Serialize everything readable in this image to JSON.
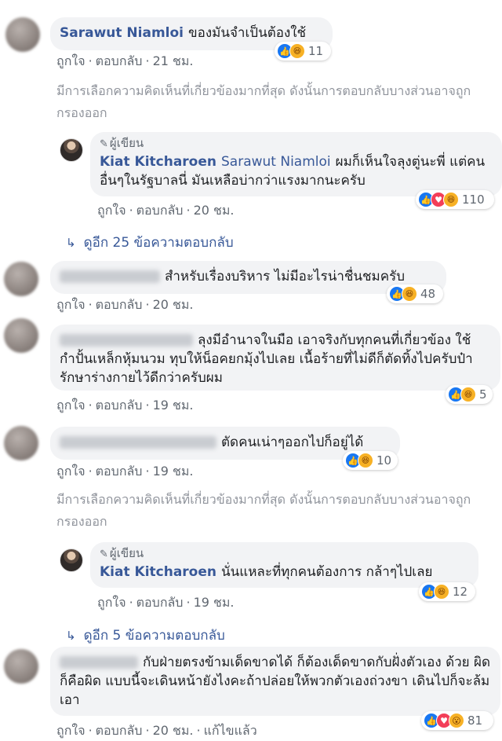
{
  "actions": {
    "like": "ถูกใจ",
    "reply": "ตอบกลับ",
    "edited": "แก้ไขแล้ว"
  },
  "notice": "มีการเลือกความคิดเห็นที่เกี่ยวข้องมากที่สุด ดังนั้นการตอบกลับบางส่วนอาจถูกกรองออก",
  "author_badge": "ผู้เขียน",
  "comments": [
    {
      "name": "Sarawut Niamloi",
      "text": "ของมันจำเป็นต้องใช้",
      "time": "21 ชม.",
      "reaction_count": "11",
      "reactions": [
        "like-icon",
        "haha-icon"
      ]
    },
    {
      "name": "Kiat Kitcharoen",
      "tag": "Sarawut Niamloi",
      "text": "ผมก็เห็นใจลุงตู่นะพี่ แต่คนอื่นๆในรัฐบาลนี่ มันเหลือบ่ากว่าแรงมากนะครับ",
      "time": "20 ชม.",
      "reaction_count": "110",
      "reactions": [
        "like-icon",
        "love-icon",
        "haha-icon"
      ]
    },
    {
      "more_replies": "ดูอีก 25 ข้อความตอบกลับ"
    },
    {
      "text": "สำหรับเรื่องบริหาร ไม่มีอะไรน่าชื่นชมครับ",
      "time": "20 ชม.",
      "reaction_count": "48",
      "reactions": [
        "like-icon",
        "haha-icon"
      ]
    },
    {
      "text": "ลุงมีอำนาจในมือ เอาจริงกับทุกคนที่เกี่ยวข้อง ใช้กำปั้นเหล็กหุ้มนวม ทุบให้น็อคยกมุ้งไปเลย เนื้อร้ายที่ไม่ดีก็ตัดทิ้งไปครับป๋า รักษาร่างกายไว้ดีกว่าครับผม",
      "time": "19 ชม.",
      "reaction_count": "5",
      "reactions": [
        "like-icon",
        "haha-icon"
      ]
    },
    {
      "text": "ตัดคนเน่าๆออกไปก็อยู่ได้",
      "time": "19 ชม.",
      "reaction_count": "10",
      "reactions": [
        "like-icon",
        "haha-icon"
      ]
    },
    {
      "name": "Kiat Kitcharoen",
      "text": "นั่นแหละที่ทุกคนต้องการ กล้าๆไปเลย",
      "time": "19 ชม.",
      "reaction_count": "12",
      "reactions": [
        "like-icon",
        "haha-icon"
      ]
    },
    {
      "more_replies": "ดูอีก 5 ข้อความตอบกลับ"
    },
    {
      "text": "กับฝ่ายตรงข้ามเด็ดขาดได้ ก็ต้องเด็ดขาดกับฝั่งตัวเอง ด้วย ผิดก็คือผิด แบบนี้จะเดินหน้ายังไงคะถ้าปล่อยให้พวกตัวเองถ่วงขา เดินไปก็จะล้มเอา",
      "time": "20 ชม.",
      "reaction_count": "81",
      "reactions": [
        "like-icon",
        "love-icon",
        "wow-icon"
      ]
    }
  ],
  "colors": {
    "link": "#385898",
    "bubble": "#f2f3f5",
    "meta": "#606770",
    "notice": "#90949c",
    "like": "#1877f2",
    "love": "#f33e58",
    "haha": "#f7b125"
  }
}
